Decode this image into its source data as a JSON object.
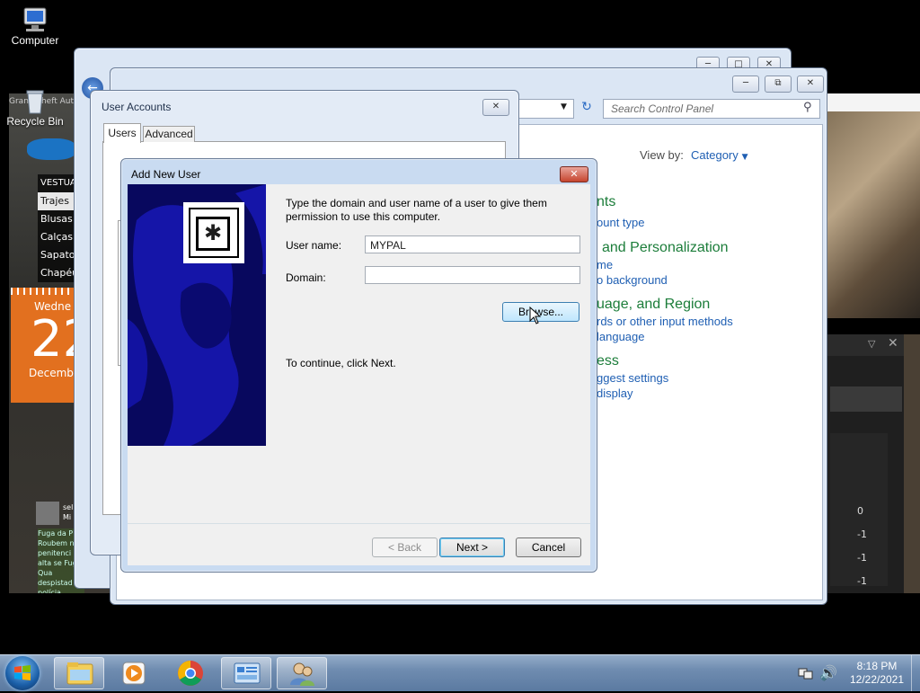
{
  "desktop": {
    "icons": [
      {
        "label": "Computer"
      },
      {
        "label": "Recycle Bin"
      }
    ],
    "bg_app": {
      "title": "Grand Theft Auto",
      "menu": [
        "VESTUARIO",
        "Trajes",
        "Blusas",
        "Calças",
        "Sapatos",
        "Chapéus"
      ],
      "calendar": {
        "day_name": "Wedne",
        "day": "22",
        "month": "Decembe"
      },
      "chat_user": "sel",
      "chat_user_sub": "Mi",
      "chat_text": "Fuga da P Roubem n penitenci de alta se Fuga Qua despistad de polícia"
    },
    "right_panel": {
      "values": [
        "0",
        "-1",
        "-1",
        "-1"
      ]
    }
  },
  "control_panel": {
    "search_placeholder": "Search Control Panel",
    "view_by_label": "View by:",
    "view_by_value": "Category",
    "items": [
      {
        "heading": "nts",
        "links": [
          "ount type"
        ]
      },
      {
        "heading": "and Personalization",
        "links": [
          "me",
          "o background"
        ]
      },
      {
        "heading": "uage, and Region",
        "links": [
          "rds or other input methods",
          "language"
        ]
      },
      {
        "heading": "ess",
        "links": [
          "ggest settings",
          "display"
        ]
      }
    ]
  },
  "user_accounts": {
    "title": "User Accounts",
    "tabs": [
      "Users",
      "Advanced"
    ]
  },
  "add_user_dialog": {
    "title": "Add New User",
    "instructions": "Type the domain and user name of a user to give them permission to use this computer.",
    "username_label": "User name:",
    "username_value": "MYPAL",
    "domain_label": "Domain:",
    "domain_value": "",
    "browse_label": "Browse...",
    "continue_text": "To continue, click Next.",
    "back_label": "< Back",
    "next_label": "Next >",
    "cancel_label": "Cancel"
  },
  "taskbar": {
    "time": "8:18 PM",
    "date": "12/22/2021",
    "buttons": [
      "windows-explorer",
      "media-player",
      "chrome",
      "control-panel",
      "user-accounts"
    ]
  }
}
